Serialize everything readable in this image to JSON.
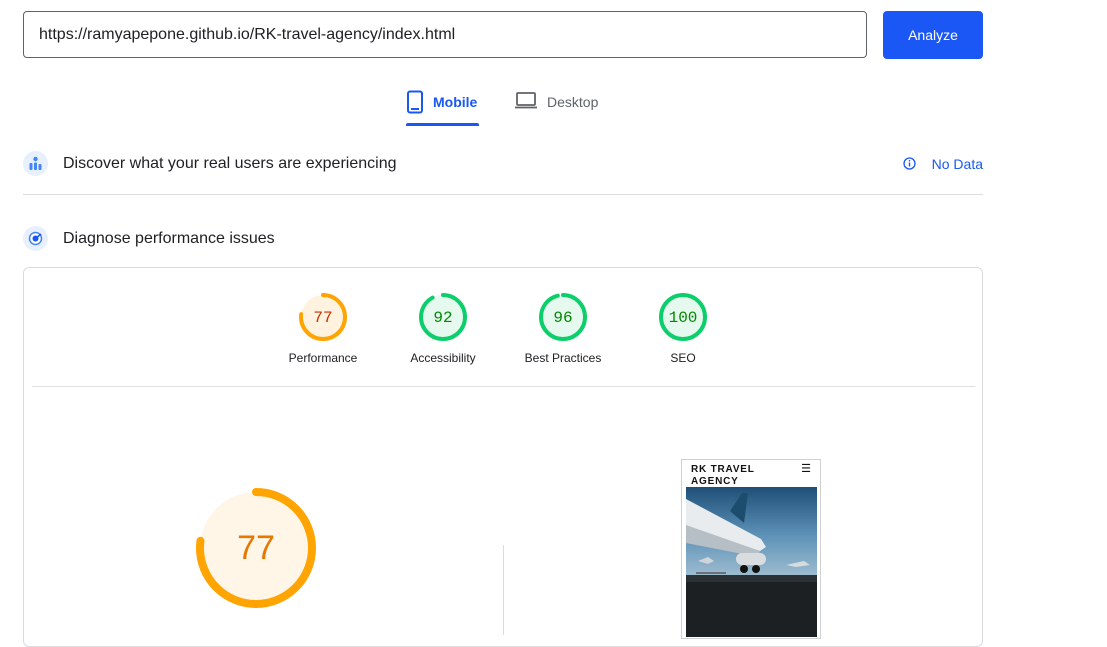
{
  "search": {
    "url_value": "https://ramyapepone.github.io/RK-travel-agency/index.html",
    "analyze_label": "Analyze"
  },
  "tabs": [
    {
      "label": "Mobile",
      "icon": "smartphone-icon",
      "active": true
    },
    {
      "label": "Desktop",
      "icon": "laptop-icon",
      "active": false
    }
  ],
  "field_data": {
    "title": "Discover what your real users are experiencing",
    "status_label": "No Data",
    "icon": "users-chart-icon"
  },
  "lab_data": {
    "title": "Diagnose performance issues",
    "icon": "lighthouse-icon"
  },
  "scores": [
    {
      "label": "Performance",
      "value": 77,
      "color": "#ffa400",
      "text_color": "#c33300",
      "fill": "#fff3e0"
    },
    {
      "label": "Accessibility",
      "value": 92,
      "color": "#0cce6b",
      "text_color": "#008800",
      "fill": "#e6f9ee"
    },
    {
      "label": "Best Practices",
      "value": 96,
      "color": "#0cce6b",
      "text_color": "#008800",
      "fill": "#e6f9ee"
    },
    {
      "label": "SEO",
      "value": 100,
      "color": "#0cce6b",
      "text_color": "#008800",
      "fill": "#e6f9ee"
    }
  ],
  "main_score": {
    "value": 77,
    "color": "#ffa400",
    "text_color": "#e67700",
    "fill": "#fff6e8"
  },
  "preview": {
    "site_title": "RK TRAVEL AGENCY",
    "menu_icon": "hamburger-menu-icon"
  },
  "colors": {
    "accent": "#1a57f4",
    "divider": "#dadce0"
  }
}
